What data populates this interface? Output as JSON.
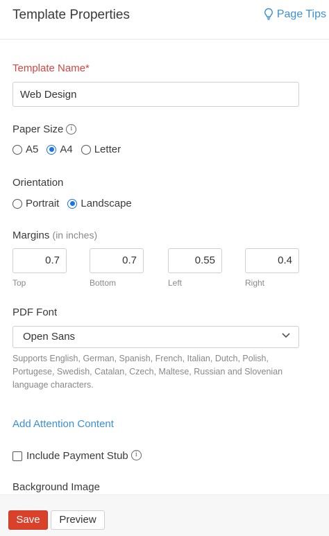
{
  "header": {
    "title": "Template Properties",
    "tips_label": "Page Tips"
  },
  "template_name": {
    "label": "Template Name*",
    "value": "Web Design"
  },
  "paper_size": {
    "label": "Paper Size",
    "options": [
      {
        "label": "A5",
        "selected": false
      },
      {
        "label": "A4",
        "selected": true
      },
      {
        "label": "Letter",
        "selected": false
      }
    ]
  },
  "orientation": {
    "label": "Orientation",
    "options": [
      {
        "label": "Portrait",
        "selected": false
      },
      {
        "label": "Landscape",
        "selected": true
      }
    ]
  },
  "margins": {
    "label": "Margins",
    "unit_note": "(in inches)",
    "fields": [
      {
        "value": "0.7",
        "caption": "Top"
      },
      {
        "value": "0.7",
        "caption": "Bottom"
      },
      {
        "value": "0.55",
        "caption": "Left"
      },
      {
        "value": "0.4",
        "caption": "Right"
      }
    ]
  },
  "pdf_font": {
    "label": "PDF Font",
    "selected": "Open Sans",
    "help": "Supports English, German, Spanish, French, Italian, Dutch, Polish, Portugese, Swedish, Catalan, Czech, Maltese, Russian and Slovenian language characters."
  },
  "attention_link": "Add Attention Content",
  "payment_stub": {
    "label": "Include Payment Stub",
    "checked": false
  },
  "background_image": {
    "label": "Background Image"
  },
  "footer": {
    "save_label": "Save",
    "preview_label": "Preview"
  },
  "colors": {
    "accent": "#3b8fd6",
    "required": "#d64541",
    "primary_button": "#d9412b",
    "radio_selected": "#1a73e8"
  }
}
